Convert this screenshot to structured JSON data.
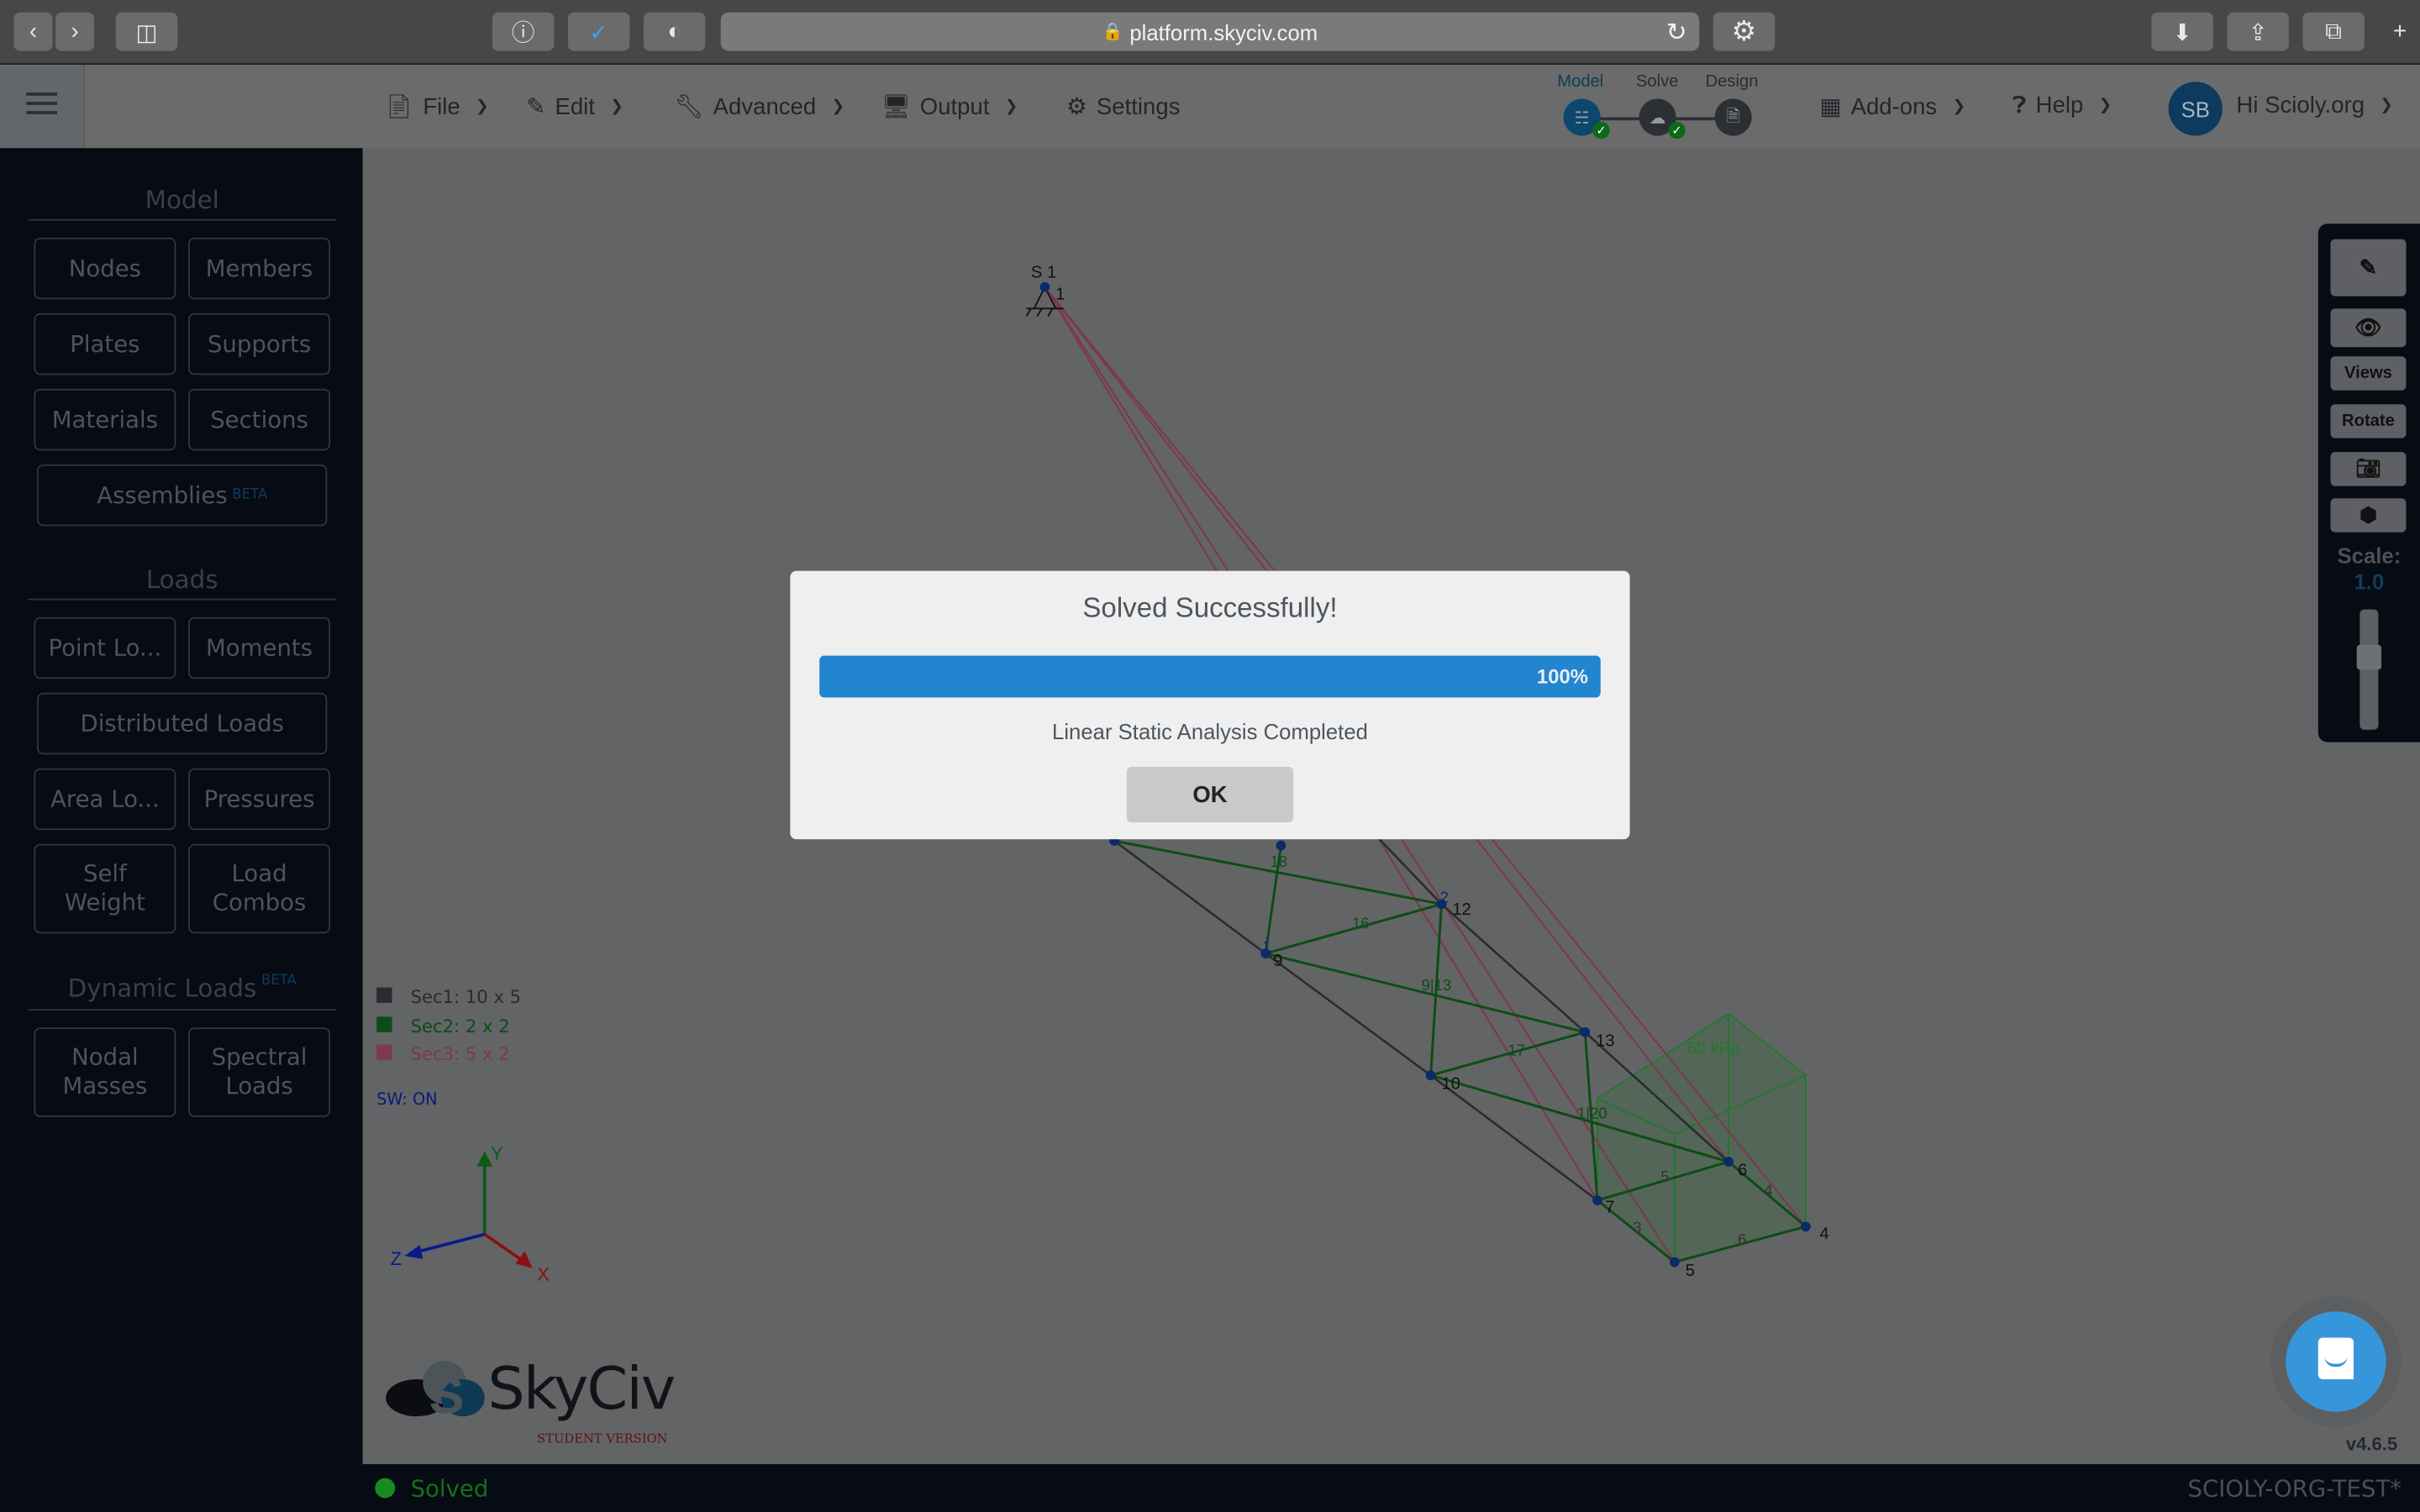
{
  "browser": {
    "url": "platform.skyciv.com",
    "icons": [
      "back-icon",
      "forward-icon",
      "sidebar-icon",
      "info-icon",
      "shield-check-icon",
      "privacy-icon",
      "lock-icon",
      "reload-icon",
      "gear-icon",
      "download-icon",
      "share-icon",
      "tabs-icon",
      "new-tab-icon"
    ]
  },
  "toolbar": {
    "menus": [
      {
        "label": "File",
        "icon": "file-icon"
      },
      {
        "label": "Edit",
        "icon": "pencil-icon"
      },
      {
        "label": "Advanced",
        "icon": "wrench-icon"
      },
      {
        "label": "Output",
        "icon": "monitor-icon"
      },
      {
        "label": "Settings",
        "icon": "gear-icon"
      }
    ],
    "steps": [
      {
        "label": "Model",
        "done": true,
        "active": true
      },
      {
        "label": "Solve",
        "done": true,
        "active": false
      },
      {
        "label": "Design",
        "done": false,
        "active": false
      }
    ],
    "addons": "Add-ons",
    "help": "Help",
    "avatar_initials": "SB",
    "greeting": "Hi Scioly.org"
  },
  "sidebar": {
    "model_title": "Model",
    "model_buttons": [
      "Nodes",
      "Members",
      "Plates",
      "Supports",
      "Materials",
      "Sections"
    ],
    "assemblies": "Assemblies",
    "beta": "BETA",
    "loads_title": "Loads",
    "load_buttons": [
      "Point Lo...",
      "Moments",
      "Distributed Loads",
      "Area Lo...",
      "Pressures",
      "Self Weight",
      "Load Combos"
    ],
    "dynamic_title": "Dynamic Loads",
    "dynamic_buttons": [
      "Nodal Masses",
      "Spectral Loads"
    ]
  },
  "legend": {
    "sections": [
      {
        "label": "Sec1: 10 x 5",
        "color": "#2a2b2e"
      },
      {
        "label": "Sec2: 2 x 2",
        "color": "#0d4c14"
      },
      {
        "label": "Sec3: 5 x 2",
        "color": "#7a3a4f"
      }
    ],
    "sw": "SW: ON"
  },
  "axes": {
    "x": "X",
    "y": "Y",
    "z": "Z"
  },
  "model": {
    "support_label": "S 1",
    "node_labels": {
      "n1": "1",
      "n9": "9",
      "n12": "12",
      "n10": "10",
      "n13": "13",
      "n7": "7",
      "n6": "6",
      "n4": "4",
      "n5": "5"
    },
    "member_labels": {
      "m18": "18",
      "m16": "16",
      "m913": "9|13",
      "m17": "17",
      "m1120": "1|20",
      "m5": "5",
      "m3": "3",
      "m4": "4",
      "m6": "6",
      "m2": "2",
      "m1": "1"
    },
    "pressure": "60 kPa"
  },
  "right_panel": {
    "views": "Views",
    "rotate": "Rotate",
    "scale_label": "Scale:",
    "scale_value": "1.0",
    "scale_fraction": 0.3
  },
  "logo": {
    "name": "SkyCiv",
    "sub": "STUDENT VERSION"
  },
  "version": "v4.6.5",
  "status": {
    "text": "Solved",
    "project": "SCIOLY-ORG-TEST*"
  },
  "dialog": {
    "title": "Solved Successfully!",
    "progress": 100,
    "progress_label": "100%",
    "message": "Linear Static Analysis Completed",
    "ok": "OK"
  }
}
